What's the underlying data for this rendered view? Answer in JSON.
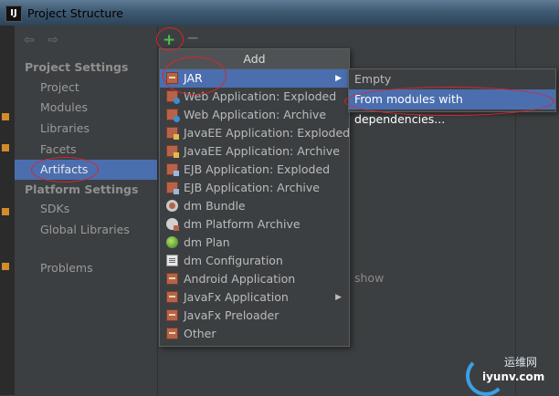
{
  "window": {
    "title": "Project Structure",
    "app_icon_text": "IJ"
  },
  "sidebar": {
    "project_settings_header": "Project Settings",
    "project_items": [
      "Project",
      "Modules",
      "Libraries",
      "Facets",
      "Artifacts"
    ],
    "selected_item": "Artifacts",
    "platform_settings_header": "Platform Settings",
    "platform_items": [
      "SDKs",
      "Global Libraries"
    ],
    "other_items": [
      "Problems"
    ]
  },
  "toolbar": {
    "add_symbol": "+",
    "remove_symbol": "−",
    "back_symbol": "⇦",
    "forward_symbol": "⇨"
  },
  "main": {
    "hint_text": "show"
  },
  "add_popup": {
    "header": "Add",
    "items": [
      {
        "label": "JAR",
        "icon": "jar-icon",
        "active": true,
        "has_submenu": true
      },
      {
        "label": "Web Application: Exploded",
        "icon": "web-icon"
      },
      {
        "label": "Web Application: Archive",
        "icon": "web-icon"
      },
      {
        "label": "JavaEE Application: Exploded",
        "icon": "javaee-icon"
      },
      {
        "label": "JavaEE Application: Archive",
        "icon": "javaee-icon"
      },
      {
        "label": "EJB Application: Exploded",
        "icon": "ejb-icon"
      },
      {
        "label": "EJB Application: Archive",
        "icon": "ejb-icon"
      },
      {
        "label": "dm Bundle",
        "icon": "bundle-icon"
      },
      {
        "label": "dm Platform Archive",
        "icon": "platform-icon"
      },
      {
        "label": "dm Plan",
        "icon": "plan-icon"
      },
      {
        "label": "dm Configuration",
        "icon": "config-icon"
      },
      {
        "label": "Android Application",
        "icon": "android-icon"
      },
      {
        "label": "JavaFx Application",
        "icon": "javafx-icon",
        "has_submenu": true
      },
      {
        "label": "JavaFx Preloader",
        "icon": "javafx-icon"
      },
      {
        "label": "Other",
        "icon": "other-icon"
      }
    ]
  },
  "jar_submenu": {
    "items": [
      "Empty",
      "From modules with dependencies..."
    ],
    "active_index": 1
  },
  "watermark": {
    "site": "iyunv.com",
    "cn": "运维网"
  },
  "colors": {
    "background": "#3c3f41",
    "selection": "#4b6eaf",
    "annotation": "#d8262d",
    "add_green": "#4cc04c"
  }
}
